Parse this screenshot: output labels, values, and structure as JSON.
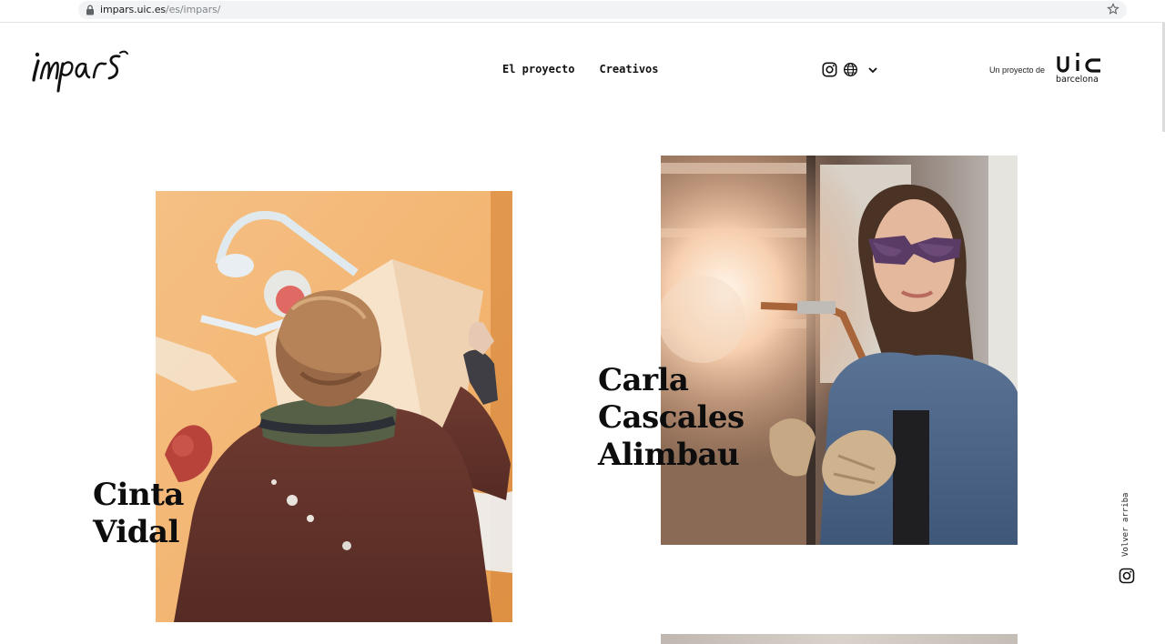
{
  "browser": {
    "url_domain": "impars.uic.es",
    "url_path": "/es/impars/"
  },
  "header": {
    "logo_text": "impars",
    "nav": [
      {
        "label": "El proyecto"
      },
      {
        "label": "Creativos"
      }
    ],
    "icons": [
      "instagram-icon",
      "globe-icon",
      "chevron-down-icon"
    ],
    "credit_label": "Un proyecto de",
    "partner_logo": {
      "main": "uic",
      "sub": "barcelona"
    }
  },
  "cards": [
    {
      "name_line1": "Cinta",
      "name_line2": "Vidal"
    },
    {
      "name_line1": "Carla",
      "name_line2": "Cascales",
      "name_line3": "Alimbau"
    }
  ],
  "rail": {
    "back_to_top": "Volver arriba",
    "icon": "instagram-icon"
  },
  "colors": {
    "text": "#111111",
    "background": "#ffffff",
    "url_bar": "#f1f3f4"
  }
}
